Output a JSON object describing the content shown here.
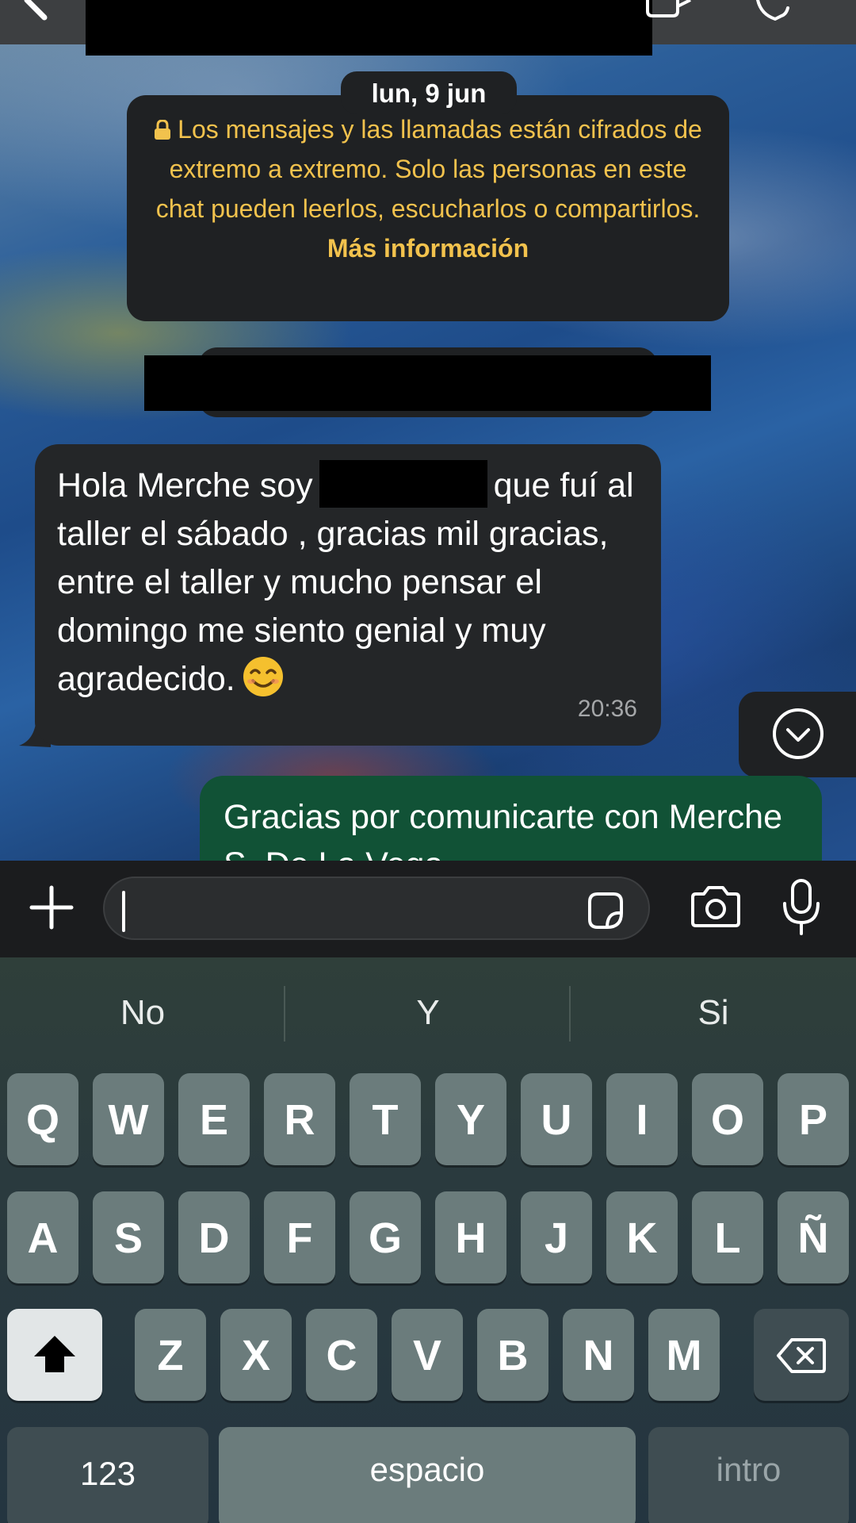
{
  "chat": {
    "date_label": "lun, 9 jun",
    "encryption_notice": "Los mensajes y las llamadas están cifrados de extremo a extremo. Solo las personas en este chat pueden leerlos, escucharlos o compartirlos.",
    "encryption_link": "Más información"
  },
  "messages": {
    "incoming": {
      "text_before_name": "Hola Merche soy",
      "text_after_name": "que fuí al taller el sábado , gracias mil gracias, entre el taller y mucho pensar el domingo me siento genial y muy agradecido.",
      "emoji": "smiling-face-emoji",
      "time": "20:36"
    },
    "outgoing": {
      "text": "Gracias por comunicarte con Merche S. De La Vega-"
    }
  },
  "composer": {
    "input_value": "",
    "icons": [
      "plus-icon",
      "sticker-icon",
      "camera-icon",
      "microphone-icon"
    ]
  },
  "keyboard": {
    "suggestions": [
      "No",
      "Y",
      "Si"
    ],
    "row1": [
      "Q",
      "W",
      "E",
      "R",
      "T",
      "Y",
      "U",
      "I",
      "O",
      "P"
    ],
    "row2": [
      "A",
      "S",
      "D",
      "F",
      "G",
      "H",
      "J",
      "K",
      "L",
      "Ñ"
    ],
    "row3": [
      "Z",
      "X",
      "C",
      "V",
      "B",
      "N",
      "M"
    ],
    "numbers_key": "123",
    "space_key": "espacio",
    "return_key": "intro"
  },
  "colors": {
    "notice_text": "#f2c24d",
    "incoming_bubble": "#242628",
    "outgoing_bubble": "#115236",
    "bar_background": "#1b1c1e"
  }
}
